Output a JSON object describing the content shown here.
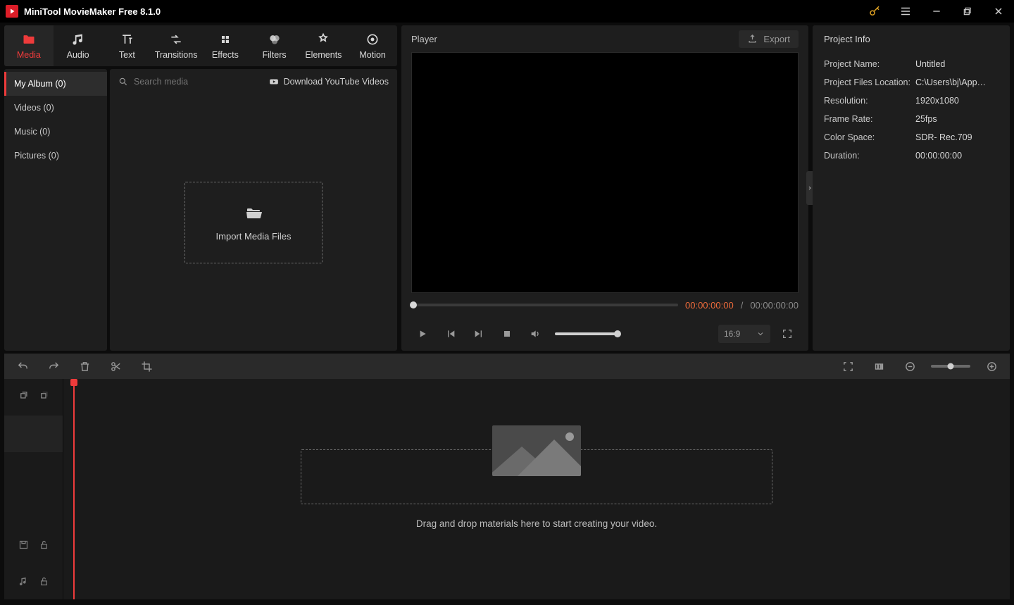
{
  "app": {
    "title": "MiniTool MovieMaker Free 8.1.0"
  },
  "tabs": {
    "media": "Media",
    "audio": "Audio",
    "text": "Text",
    "transitions": "Transitions",
    "effects": "Effects",
    "filters": "Filters",
    "elements": "Elements",
    "motion": "Motion"
  },
  "albums": {
    "my_album": "My Album (0)",
    "videos": "Videos (0)",
    "music": "Music (0)",
    "pictures": "Pictures (0)"
  },
  "media": {
    "search_placeholder": "Search media",
    "download_yt": "Download YouTube Videos",
    "import_label": "Import Media Files"
  },
  "player": {
    "title": "Player",
    "export": "Export",
    "cur_time": "00:00:00:00",
    "sep": " / ",
    "tot_time": "00:00:00:00",
    "aspect": "16:9"
  },
  "info": {
    "header": "Project Info",
    "rows": {
      "name_k": "Project Name:",
      "name_v": "Untitled",
      "loc_k": "Project Files Location:",
      "loc_v": "C:\\Users\\bj\\App…",
      "res_k": "Resolution:",
      "res_v": "1920x1080",
      "fps_k": "Frame Rate:",
      "fps_v": "25fps",
      "cs_k": "Color Space:",
      "cs_v": "SDR- Rec.709",
      "dur_k": "Duration:",
      "dur_v": "00:00:00:00"
    }
  },
  "timeline": {
    "hint": "Drag and drop materials here to start creating your video."
  }
}
